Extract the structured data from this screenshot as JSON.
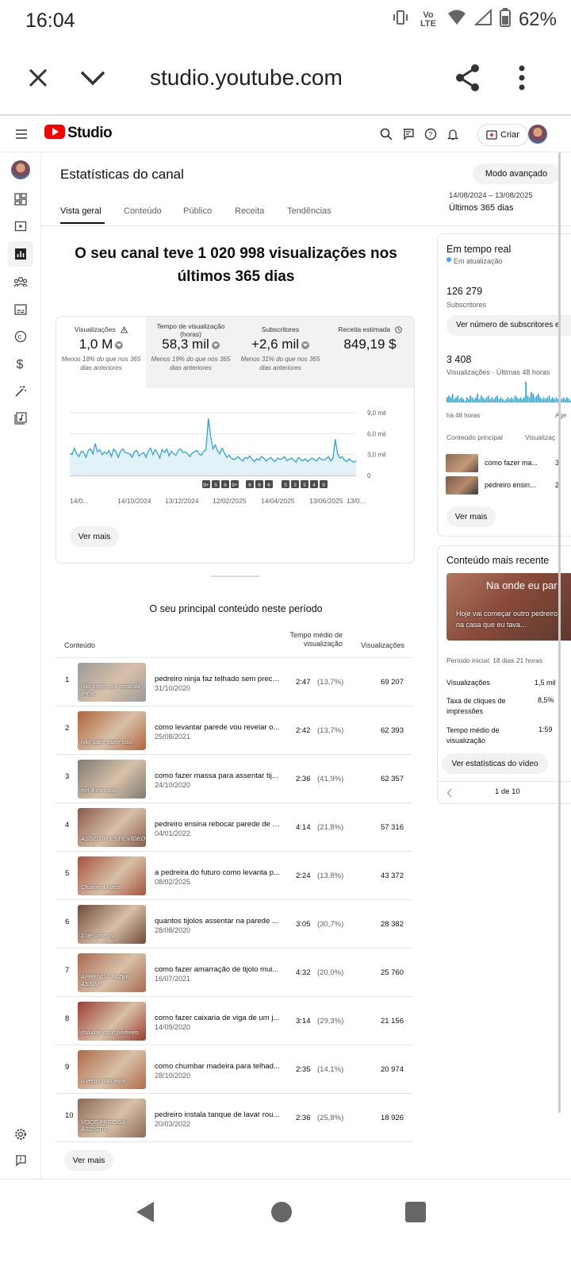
{
  "status_bar": {
    "time": "16:04",
    "network": "Vo LTE",
    "battery": "62%"
  },
  "browser": {
    "url": "studio.youtube.com"
  },
  "header": {
    "logo": "Studio",
    "create_label": "Criar"
  },
  "page": {
    "title": "Estatísticas do canal",
    "advanced_mode": "Modo avançado",
    "date_range": "14/08/2024 – 13/08/2025",
    "period": "Últimos 365 dias",
    "tabs": [
      "Vista geral",
      "Conteúdo",
      "Público",
      "Receita",
      "Tendências"
    ],
    "headline": "O seu canal teve 1 020 998 visualizações nos últimos 365 dias"
  },
  "metrics": [
    {
      "label": "Visualizações",
      "value": "1,0 M",
      "note": "Menos 18% do que nos 365 dias anteriores"
    },
    {
      "label": "Tempo de visualização (horas)",
      "value": "58,3 mil",
      "note": "Menos 19% do que nos 365 dias anteriores"
    },
    {
      "label": "Subscritores",
      "value": "+2,6 mil",
      "note": "Menos 31% do que nos 365 dias anteriores"
    },
    {
      "label": "Receita estimada",
      "value": "849,19 $",
      "note": ""
    }
  ],
  "chart_data": {
    "type": "line",
    "x_tick_labels": [
      "14/0...",
      "14/10/2024",
      "13/12/2024",
      "12/02/2025",
      "14/04/2025",
      "13/06/2025",
      "13/0..."
    ],
    "y_tick_labels": [
      "9,0 mil",
      "6,0 mil",
      "3,0 mil",
      "0"
    ],
    "ylim": [
      0,
      9000
    ],
    "series": [
      {
        "values": [
          3200,
          3000,
          3900,
          3100,
          2700,
          3500,
          3300,
          2600,
          3600,
          3800,
          3100,
          4600,
          3400,
          3700,
          3000,
          3400,
          3100,
          3600,
          2700,
          3800,
          3400,
          2600,
          3500,
          3800,
          3300,
          3200,
          3100,
          2600,
          3400,
          3600,
          2800,
          3100,
          3300,
          2600,
          3500,
          3900,
          3000,
          3700,
          3200,
          2500,
          3700,
          3300,
          3800,
          2800,
          3500,
          3100,
          2900,
          3600,
          3800,
          3300,
          3400,
          3100,
          2700,
          3200,
          3400,
          3600,
          3100,
          2900,
          3500,
          3700,
          8200,
          5600,
          3800,
          4400,
          3500,
          3100,
          3900,
          3200,
          2600,
          2900,
          2500,
          2300,
          2400,
          2700,
          2300,
          2100,
          2600,
          2400,
          2800,
          2300,
          2000,
          2400,
          2200,
          2700,
          2500,
          2100,
          2300,
          2600,
          2200,
          2000,
          2500,
          2300,
          2400,
          2700,
          2100,
          2300,
          2500,
          2200,
          1900,
          2600,
          2300,
          2100,
          2400,
          2000,
          2300,
          2500,
          2200,
          2100,
          2600,
          2300,
          2200,
          2400,
          2700,
          2100,
          2500,
          5200,
          3100,
          2500,
          2700,
          2200,
          2000,
          2400,
          2100,
          1900,
          2100
        ]
      }
    ],
    "event_badges": [
      "9+",
      "5",
      "6",
      "9+",
      "6",
      "6",
      "6",
      "5",
      "3",
      "5",
      "4",
      "9"
    ]
  },
  "see_more": "Ver mais",
  "top_content": {
    "title": "O seu principal conteúdo neste período",
    "col_content": "Conteúdo",
    "col_avg_time": "Tempo médio de visualização",
    "col_views": "Visualizações",
    "rows": [
      {
        "num": "1",
        "title": "pedreiro ninja faz telhado sem preci...",
        "date": "31/10/2020",
        "time": "2:47",
        "pct": "(13,7%)",
        "views": "69 207",
        "thumb_text": "não corte; por cima da telha",
        "thumb_color": "#9a9a9a"
      },
      {
        "num": "2",
        "title": "como levantar parede vou revelar o...",
        "date": "25/08/2021",
        "time": "2:42",
        "pct": "(13,7%)",
        "views": "62 393",
        "thumb_text": "não sabe fazer isso",
        "thumb_color": "#b0643c"
      },
      {
        "num": "3",
        "title": "como fazer massa para assentar tij...",
        "date": "24/10/2020",
        "time": "2:36",
        "pct": "(41,9%)",
        "views": "62 357",
        "thumb_text": "em 4 minutos",
        "thumb_color": "#7d7d74"
      },
      {
        "num": "4",
        "title": "pedreiro ensina rebocar parede de u...",
        "date": "04/01/2022",
        "time": "4:14",
        "pct": "(21,8%)",
        "views": "57 316",
        "thumb_text": "ASSISTIR ESTE VÍDEO",
        "thumb_color": "#8a5a4a"
      },
      {
        "num": "5",
        "title": "a pedreira do futuro como levanta p...",
        "date": "08/02/2025",
        "time": "2:24",
        "pct": "(13,8%)",
        "views": "43 372",
        "thumb_text": "Chame a Nasa",
        "thumb_color": "#a4523a"
      },
      {
        "num": "6",
        "title": "quantos tijolos assentar na parede ...",
        "date": "28/08/2020",
        "time": "3:05",
        "pct": "(30,7%)",
        "views": "28 382",
        "thumb_text": "1 de cimento",
        "thumb_color": "#6e4a3a"
      },
      {
        "num": "7",
        "title": "como fazer amarração de tijolo mui...",
        "date": "16/07/2021",
        "time": "4:32",
        "pct": "(20,0%)",
        "views": "25 760",
        "thumb_text": "APRENDA FAZER ASSIM",
        "thumb_color": "#a86a4e"
      },
      {
        "num": "8",
        "title": "como fazer caixaria de viga de um j...",
        "date": "14/09/2020",
        "time": "3:14",
        "pct": "(29,3%)",
        "views": "21 156",
        "thumb_text": "estudar esse pedreiro",
        "thumb_color": "#9c3d32"
      },
      {
        "num": "9",
        "title": "como chumbar madeira para telhad...",
        "date": "28/10/2020",
        "time": "2:35",
        "pct": "(14,1%)",
        "views": "20 974",
        "thumb_text": "o vento não leva",
        "thumb_color": "#b06a48"
      },
      {
        "num": "10",
        "title": "pedreiro instala tanque de lavar rou...",
        "date": "20/03/2022",
        "time": "2:36",
        "pct": "(25,8%)",
        "views": "18 926",
        "thumb_text": "VOCÊ PRECISA ASSISTIR",
        "thumb_color": "#8a6a54"
      }
    ]
  },
  "realtime": {
    "title": "Em tempo real",
    "updating": "Em atualização",
    "subs_value": "126 279",
    "subs_label": "Subscritores",
    "subs_button": "Ver número de subscritores e",
    "views_value": "3 408",
    "views_label": "Visualizações · Últimas 48 horas",
    "axis_left": "há 48 horas",
    "axis_right": "Age",
    "col_content": "Conteúdo principal",
    "col_views": "Visualizaç",
    "items": [
      {
        "title": "como fazer ma...",
        "views": "3"
      },
      {
        "title": "pedreiro ensin...",
        "views": "2"
      }
    ],
    "bars": [
      3,
      4,
      3,
      5,
      2,
      3,
      4,
      2,
      3,
      2,
      1,
      3,
      2,
      4,
      3,
      2,
      3,
      5,
      2,
      4,
      3,
      2,
      3,
      4,
      2,
      3,
      2,
      3,
      4,
      2,
      3,
      2,
      1,
      2,
      3,
      2,
      3,
      2,
      4,
      3,
      2,
      3,
      2,
      3,
      12,
      4,
      3,
      6,
      5,
      3,
      4,
      5,
      3,
      2,
      3,
      2,
      3,
      4,
      2,
      3,
      2,
      3,
      2,
      1,
      2,
      3,
      2,
      3,
      2,
      1
    ]
  },
  "recent": {
    "title": "Conteúdo mais recente",
    "thumb_title": "Na onde eu par",
    "thumb_caption": "Hoje vai começar outro pedreiro na casa que eu tava...",
    "period": "Período inicial: 18 dias 21 horas",
    "stats": [
      {
        "label": "Visualizações",
        "value": "1,5 mil"
      },
      {
        "label": "Taxa de cliques de impressões",
        "value": "8,5%"
      },
      {
        "label": "Tempo médio de visualização",
        "value": "1:59"
      }
    ],
    "button": "Ver estatísticas do vídeo",
    "pager": "1 de 10"
  }
}
